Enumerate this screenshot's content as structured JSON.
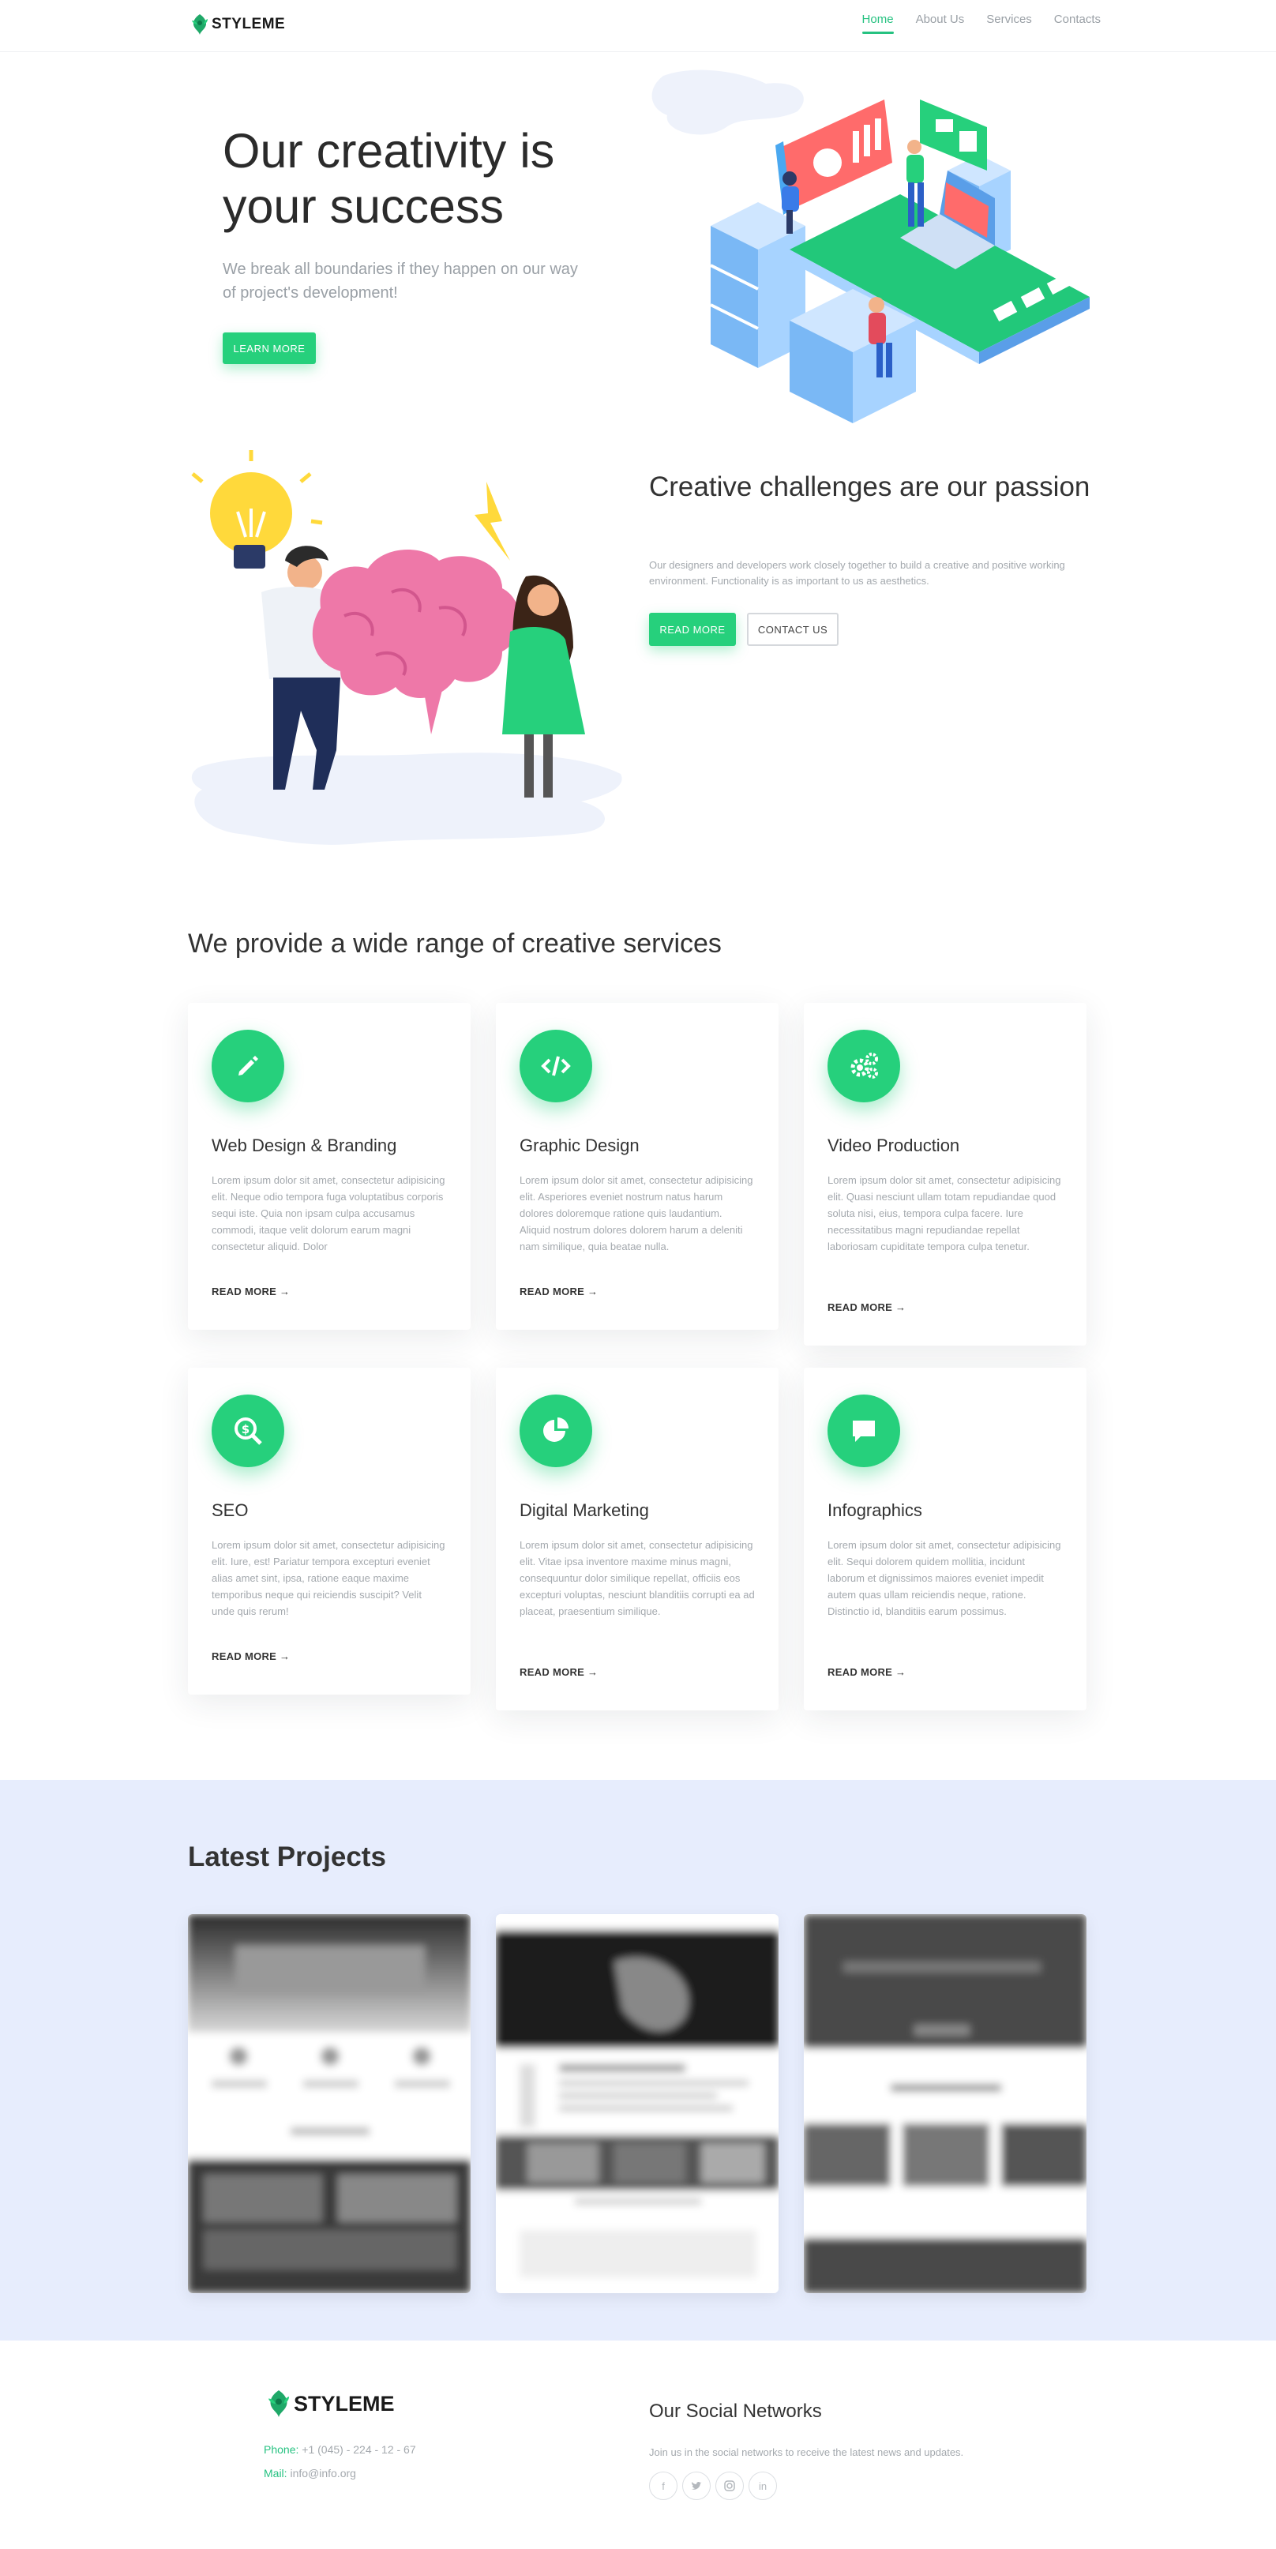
{
  "brand": {
    "name": "STYLEME",
    "accent": "#26d07c",
    "logo_icon": "leaf-splash-logo"
  },
  "nav": {
    "items": [
      "Home",
      "About Us",
      "Services",
      "Contacts"
    ],
    "active": "Home"
  },
  "hero": {
    "title": "Our creativity is your success",
    "subtitle": "We break all boundaries if they happen on our way of project's development!",
    "button": "LEARN MORE",
    "illustration": "isometric-office-illustration"
  },
  "challenges": {
    "title": "Creative challenges are our passion",
    "text": "Our designers and developers work closely together to build a creative and positive working environment. Functionality is as important to us as aesthetics.",
    "primary_button": "READ MORE",
    "secondary_button": "CONTACT US",
    "illustration": "brainstorm-illustration"
  },
  "services": {
    "title": "We provide a wide range of creative services",
    "read_more": "READ MORE →",
    "items": [
      {
        "icon": "pencil-icon",
        "title": "Web Design & Branding",
        "text": "Lorem ipsum dolor sit amet, consectetur adipisicing elit. Neque odio tempora fuga voluptatibus corporis sequi iste. Quia non ipsam culpa accusamus commodi, itaque velit dolorum earum magni consectetur aliquid. Dolor"
      },
      {
        "icon": "code-icon",
        "title": "Graphic Design",
        "text": "Lorem ipsum dolor sit amet, consectetur adipisicing elit. Asperiores eveniet nostrum natus harum dolores doloremque ratione quis laudantium. Aliquid nostrum dolores dolorem harum a deleniti nam similique, quia beatae nulla."
      },
      {
        "icon": "gears-icon",
        "title": "Video Production",
        "text": "Lorem ipsum dolor sit amet, consectetur adipisicing elit. Quasi nesciunt ullam totam repudiandae quod soluta nisi, eius, tempora culpa facere. Iure necessitatibus magni repudiandae repellat laboriosam cupiditate tempora culpa tenetur."
      },
      {
        "icon": "search-dollar-icon",
        "title": "SEO",
        "text": "Lorem ipsum dolor sit amet, consectetur adipisicing elit. Iure, est! Pariatur tempora excepturi eveniet alias amet sint, ipsa, ratione eaque maxime temporibus neque qui reiciendis suscipit? Velit unde quis rerum!"
      },
      {
        "icon": "pie-chart-icon",
        "title": "Digital Marketing",
        "text": "Lorem ipsum dolor sit amet, consectetur adipisicing elit. Vitae ipsa inventore maxime minus magni, consequuntur dolor similique repellat, officiis eos excepturi voluptas, nesciunt blanditiis corrupti ea ad placeat, praesentium similique."
      },
      {
        "icon": "chat-bubble-icon",
        "title": "Infographics",
        "text": "Lorem ipsum dolor sit amet, consectetur adipisicing elit. Sequi dolorem quidem mollitia, incidunt laborum et dignissimos maiores eveniet impedit autem quas ullam reiciendis neque, ratione. Distinctio id, blanditiis earum possimus."
      }
    ]
  },
  "projects": {
    "title": "Latest Projects",
    "items": [
      "project-thumbnail-1",
      "project-thumbnail-2",
      "project-thumbnail-3"
    ]
  },
  "footer": {
    "logo": "STYLEME",
    "phone_label": "Phone:",
    "phone": "+1 (045) - 224 - 12 - 67",
    "mail_label": "Mail:",
    "mail": "info@info.org",
    "social_title": "Our Social Networks",
    "social_text": "Join us in the social networks to receive the latest news and updates.",
    "social_icons": [
      "facebook-icon",
      "twitter-icon",
      "instagram-icon",
      "linkedin-icon"
    ]
  }
}
